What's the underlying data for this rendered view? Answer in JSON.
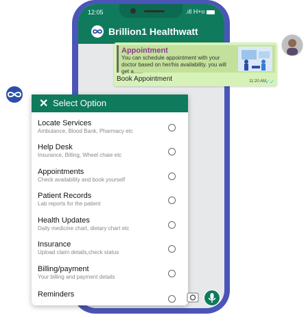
{
  "colors": {
    "primary_green": "#0f7a5c",
    "phone_frame": "#4a55b8",
    "bubble_bg": "#d7f2b8",
    "preview_title": "#8e3a8e"
  },
  "status_bar": {
    "time": "12:05",
    "signal": ".ıll H+ıı"
  },
  "app": {
    "title": "Brillion1 Healthwatt"
  },
  "message": {
    "preview_title": "Appointment",
    "preview_description": "You can schedule appointment with your doctor based on her/his availability. you will get a......",
    "text": "Book Appointment",
    "time": "11:20 AM",
    "status": "✓✓"
  },
  "menu": {
    "close_symbol": "✕",
    "title": "Select Option",
    "items": [
      {
        "title": "Locate Services",
        "subtitle": "Ambulance, Blood Bank, Pharmacy etc"
      },
      {
        "title": "Help Desk",
        "subtitle": "Insurance, Billing, Wheel chaie etc"
      },
      {
        "title": "Appointments",
        "subtitle": "Check availability and book yourself"
      },
      {
        "title": "Patient Records",
        "subtitle": "Lab reports for the patient"
      },
      {
        "title": "Health Updates",
        "subtitle": "Daily medicine chart, dietary chart etc"
      },
      {
        "title": "Insurance",
        "subtitle": "Upload claim details,check status"
      },
      {
        "title": "Billing/payment",
        "subtitle": "Your billing and payment details"
      },
      {
        "title": "Reminders",
        "subtitle": ""
      }
    ]
  },
  "icons": {
    "logo": "infinity-logo",
    "close": "close-icon",
    "mic": "mic-icon",
    "attach": "camera-icon",
    "avatar": "user-avatar"
  }
}
